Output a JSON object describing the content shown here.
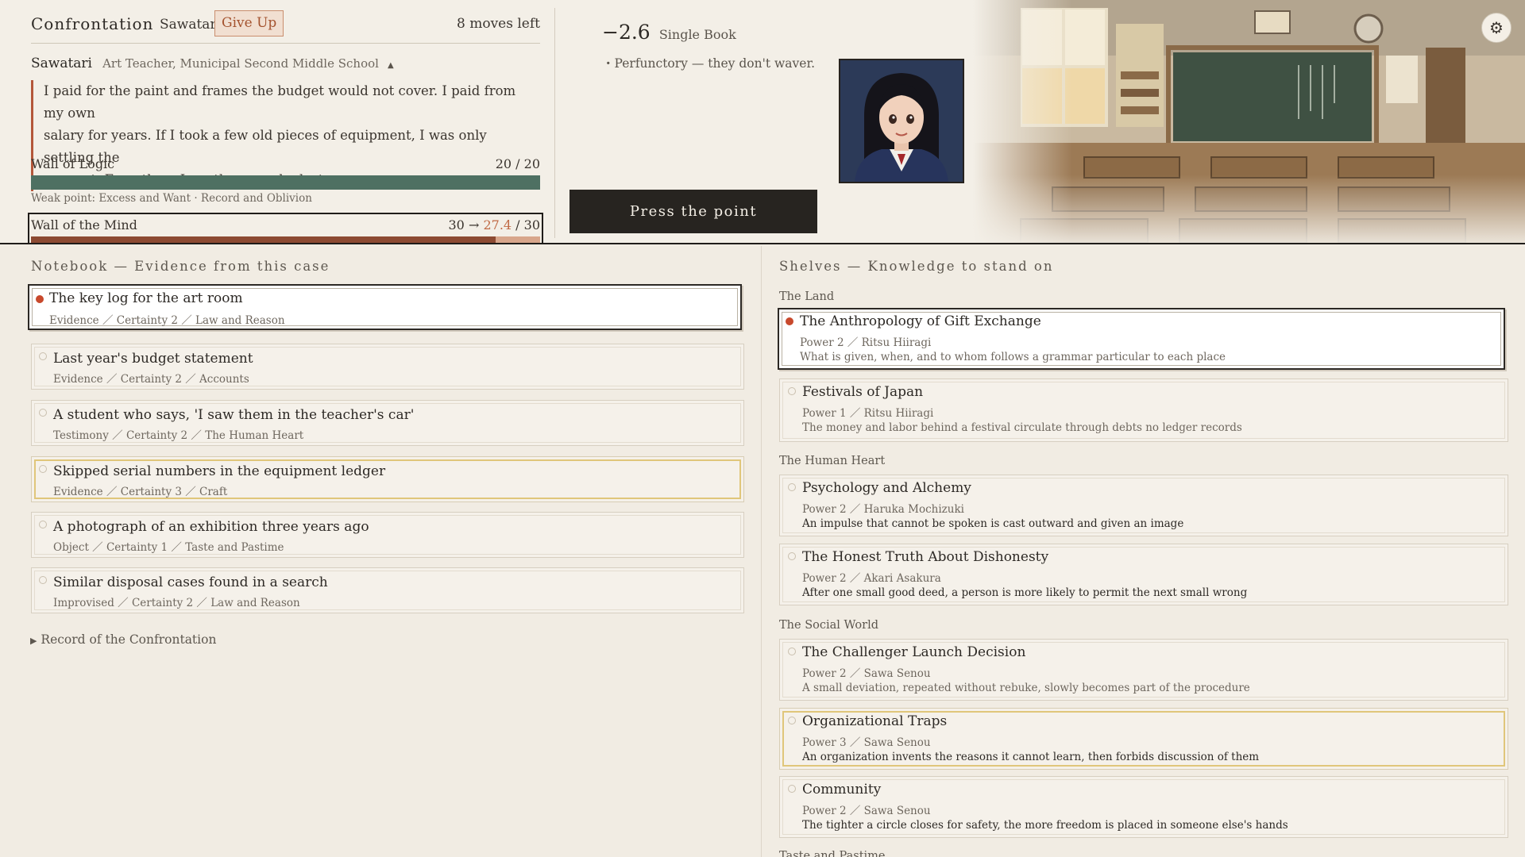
{
  "confrontation": {
    "title": "Confrontation",
    "opponent": "Sawatari",
    "give_up_label": "Give Up",
    "moves_left": "8 moves left",
    "speaker_name": "Sawatari",
    "speaker_role": "Art Teacher, Municipal Second Middle School",
    "toggle_glyph": "▲",
    "quote_lines": [
      "I paid for the paint and frames the budget would not cover. I paid from my own",
      "salary for years. If I took a few old pieces of equipment, I was only settling the",
      "account. Even then, I am the one who lost."
    ],
    "wall_logic": {
      "label": "Wall of Logic",
      "value_text": "20 / 20",
      "fraction": 1.0,
      "color": "#4e7062"
    },
    "weak_point": "Weak point: Excess and Want · Record and Oblivion",
    "wall_mind": {
      "label": "Wall of the Mind",
      "value_before": "30 →",
      "value_after": "27.4",
      "value_max": " / 30",
      "fraction": 0.913,
      "preview_fraction": 1.0,
      "color": "#8c4a32",
      "preview_color": "#d8a68b"
    }
  },
  "attack": {
    "amount": "−2.6",
    "kind": "Single Book",
    "note": "・Perfunctory — they don't waver.",
    "press_label": "Press the point"
  },
  "settings": {
    "icon": "gear-icon",
    "glyph": "⚙"
  },
  "notebook": {
    "title": "Notebook — Evidence from this case",
    "items": [
      {
        "title": "The key log for the art room",
        "meta": "Evidence ／ Certainty 2 ／ Law and Reason",
        "state": "selected"
      },
      {
        "title": "Last year's budget statement",
        "meta": "Evidence ／ Certainty 2 ／ Accounts",
        "state": "normal"
      },
      {
        "title": "A student who says, 'I saw them in the teacher's car'",
        "meta": "Testimony ／ Certainty 2 ／ The Human Heart",
        "state": "normal"
      },
      {
        "title": "Skipped serial numbers in the equipment ledger",
        "meta": "Evidence ／ Certainty 3 ／ Craft",
        "state": "gold"
      },
      {
        "title": "A photograph of an exhibition three years ago",
        "meta": "Object ／ Certainty 1 ／ Taste and Pastime",
        "state": "normal"
      },
      {
        "title": "Similar disposal cases found in a search",
        "meta": "Improvised ／ Certainty 2 ／ Law and Reason",
        "state": "normal"
      }
    ],
    "record_label": "Record of the Confrontation",
    "record_glyph": "▶"
  },
  "shelves": {
    "title": "Shelves — Knowledge to stand on",
    "categories": [
      {
        "name": "The Land"
      },
      {
        "name": "The Human Heart"
      },
      {
        "name": "The Social World"
      },
      {
        "name": "Taste and Pastime"
      }
    ],
    "books": [
      {
        "title": "The Anthropology of Gift Exchange",
        "meta": "Power 2 ／ Ritsu Hiiragi",
        "desc": "What is given, when, and to whom follows a grammar particular to each place",
        "state": "selected",
        "tone": "faint"
      },
      {
        "title": "Festivals of Japan",
        "meta": "Power 1 ／ Ritsu Hiiragi",
        "desc": "The money and labor behind a festival circulate through debts no ledger records",
        "state": "normal",
        "tone": "faint"
      },
      {
        "title": "Psychology and Alchemy",
        "meta": "Power 2 ／ Haruka Mochizuki",
        "desc": "An impulse that cannot be spoken is cast outward and given an image",
        "state": "normal",
        "tone": "dark"
      },
      {
        "title": "The Honest Truth About Dishonesty",
        "meta": "Power 2 ／ Akari Asakura",
        "desc": "After one small good deed, a person is more likely to permit the next small wrong",
        "state": "normal",
        "tone": "dark"
      },
      {
        "title": "The Challenger Launch Decision",
        "meta": "Power 2 ／ Sawa Senou",
        "desc": "A small deviation, repeated without rebuke, slowly becomes part of the procedure",
        "state": "normal",
        "tone": "faint"
      },
      {
        "title": "Organizational Traps",
        "meta": "Power 3 ／ Sawa Senou",
        "desc": "An organization invents the reasons it cannot learn, then forbids discussion of them",
        "state": "gold",
        "tone": "dark"
      },
      {
        "title": "Community",
        "meta": "Power 2 ／ Sawa Senou",
        "desc": "The tighter a circle closes for safety, the more freedom is placed in someone else's hands",
        "state": "normal",
        "tone": "dark"
      }
    ]
  }
}
